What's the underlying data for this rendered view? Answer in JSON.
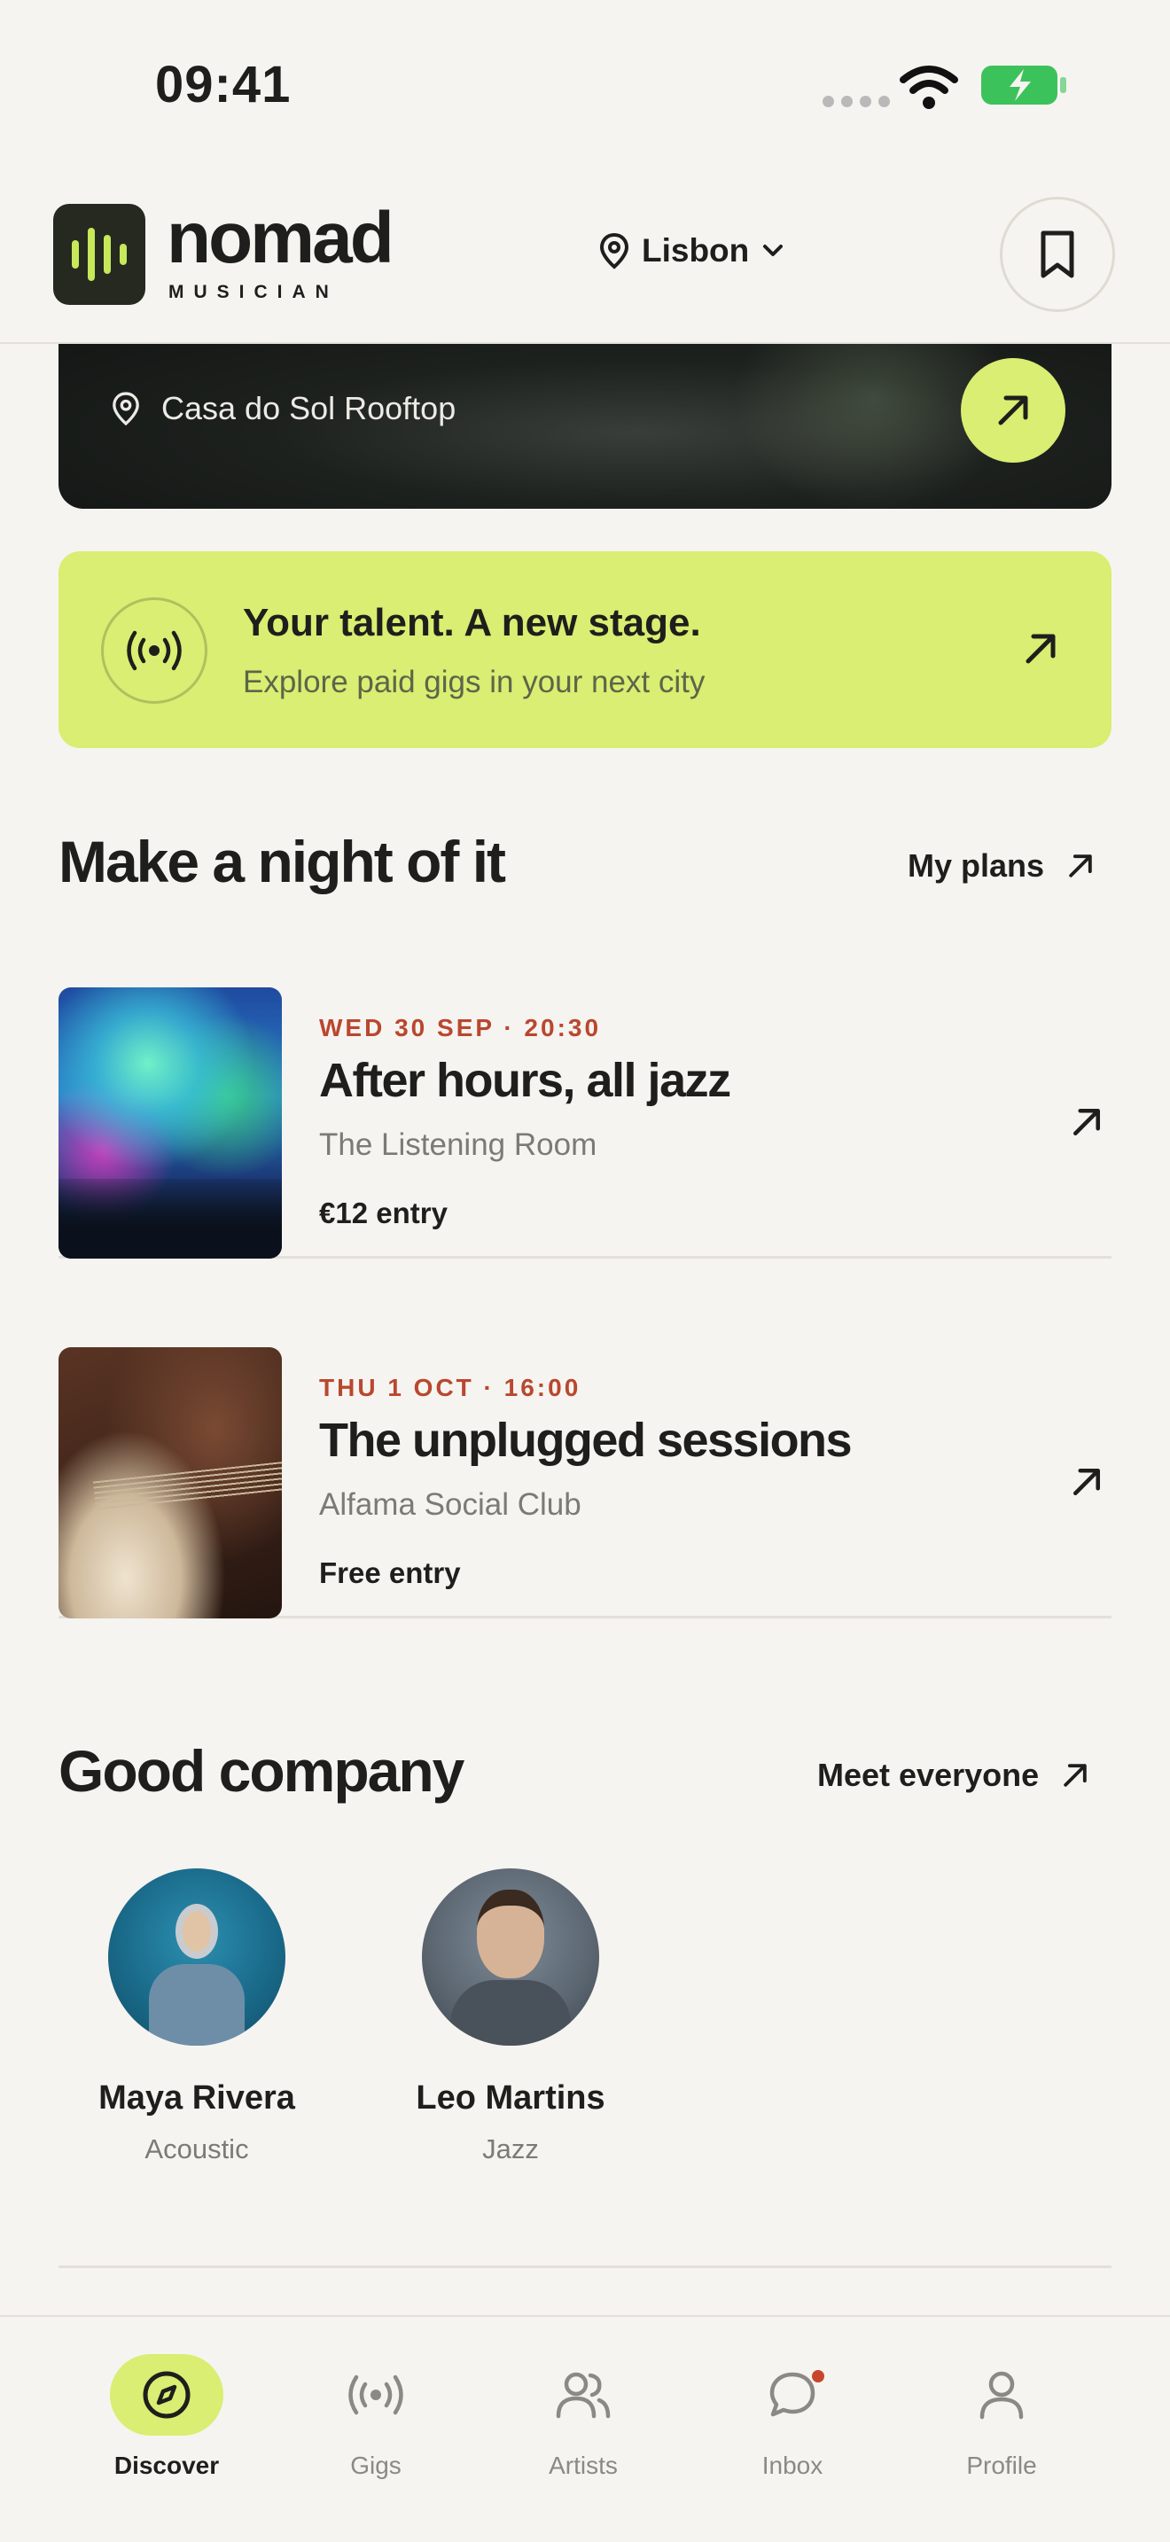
{
  "status_bar": {
    "time": "09:41"
  },
  "header": {
    "logo_text": "nomad",
    "logo_subtitle": "MUSICIAN",
    "city": "Lisbon"
  },
  "venue_card": {
    "venue_name": "Casa do Sol Rooftop"
  },
  "promo": {
    "title": "Your talent. A new stage.",
    "subtitle": "Explore paid gigs in your next city"
  },
  "events_section": {
    "title": "Make a night of it",
    "link_label": "My plans",
    "events": [
      {
        "date": "WED 30 SEP · 20:30",
        "title": "After hours, all jazz",
        "venue": "The Listening Room",
        "price": "€12 entry"
      },
      {
        "date": "THU 1 OCT · 16:00",
        "title": "The unplugged sessions",
        "venue": "Alfama Social Club",
        "price": "Free entry"
      }
    ]
  },
  "people_section": {
    "title": "Good company",
    "link_label": "Meet everyone",
    "people": [
      {
        "name": "Maya Rivera",
        "genre": "Acoustic"
      },
      {
        "name": "Leo Martins",
        "genre": "Jazz"
      }
    ]
  },
  "tab_bar": {
    "active": "Discover",
    "tabs": [
      {
        "label": "Discover",
        "icon": "compass-icon"
      },
      {
        "label": "Gigs",
        "icon": "broadcast-icon"
      },
      {
        "label": "Artists",
        "icon": "users-icon"
      },
      {
        "label": "Inbox",
        "icon": "chat-bubble-icon"
      },
      {
        "label": "Profile",
        "icon": "user-icon"
      }
    ]
  },
  "colors": {
    "background": "#f6f4f0",
    "accent": "#d9ee72",
    "date_red": "#b9472f",
    "text_dark": "#1e1f1c"
  }
}
